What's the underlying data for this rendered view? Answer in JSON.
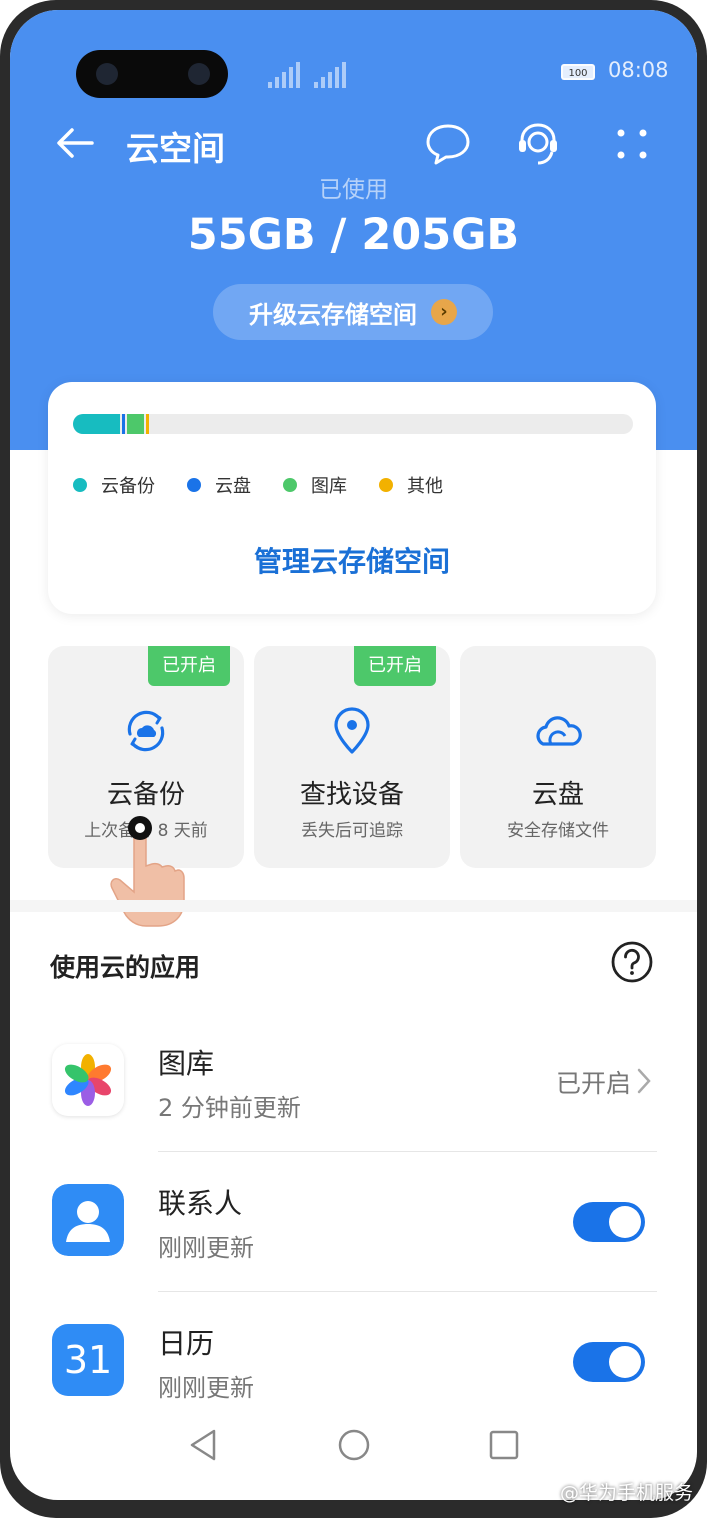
{
  "status_bar": {
    "battery": "100",
    "time": "08:08"
  },
  "header": {
    "title": "云空间"
  },
  "usage": {
    "label": "已使用",
    "value": "55GB / 205GB",
    "upgrade_label": "升级云存储空间"
  },
  "storage": {
    "breakdown_gb": {
      "cloud_backup": 17.1,
      "cloud_drive": 0.4,
      "gallery": 6.3,
      "other": 0.3
    },
    "legend": [
      "云备份",
      "云盘",
      "图库",
      "其他"
    ],
    "colors": {
      "cloud_backup": "#17bcc0",
      "cloud_drive": "#1a73e8",
      "gallery": "#4dc86a",
      "other": "#f2b100"
    },
    "manage_label": "管理云存储空间"
  },
  "tiles": [
    {
      "badge": "已开启",
      "title": "云备份",
      "subtitle": "上次备份 8 天前",
      "icon": "cloud-backup-icon"
    },
    {
      "badge": "已开启",
      "title": "查找设备",
      "subtitle": "丢失后可追踪",
      "icon": "location-pin-icon"
    },
    {
      "title": "云盘",
      "subtitle": "安全存储文件",
      "icon": "cloud-drive-icon"
    }
  ],
  "apps_section": {
    "title": "使用云的应用"
  },
  "apps": [
    {
      "name": "图库",
      "subtitle": "2 分钟前更新",
      "status": "已开启",
      "icon": "gallery-icon"
    },
    {
      "name": "联系人",
      "subtitle": "刚刚更新",
      "enabled": true,
      "icon": "contacts-icon"
    },
    {
      "name": "日历",
      "subtitle": "刚刚更新",
      "enabled": true,
      "icon": "calendar-icon",
      "icon_text": "31"
    }
  ],
  "watermark": "@华为手机服务"
}
